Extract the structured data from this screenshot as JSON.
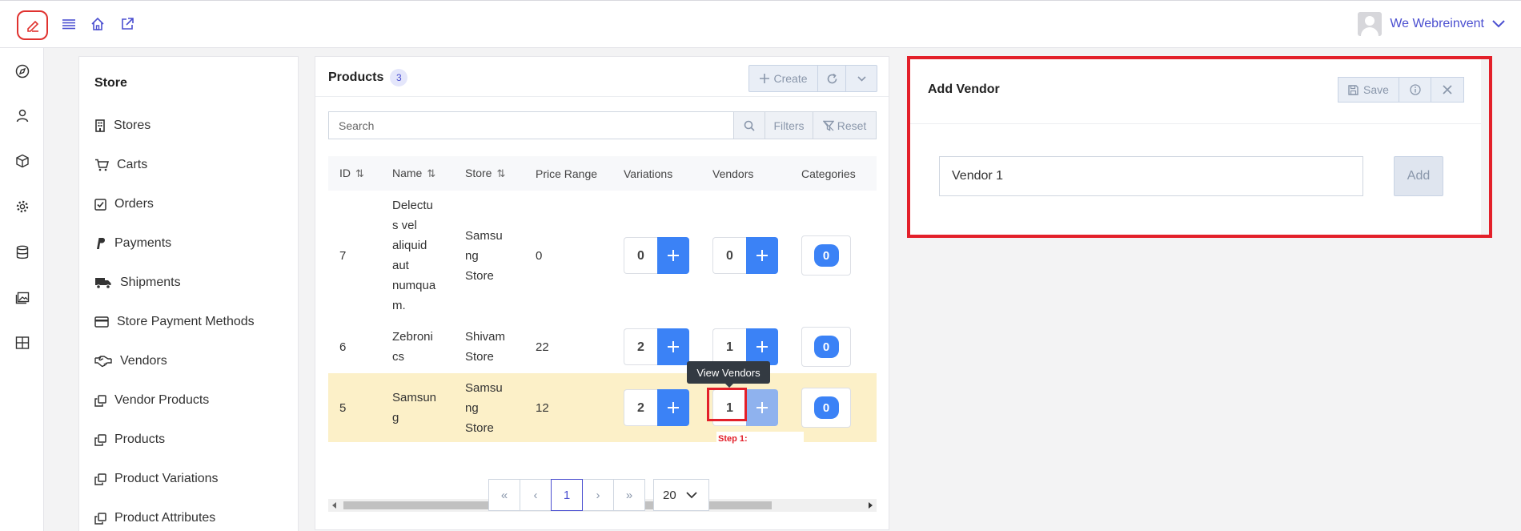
{
  "topbar": {
    "icons": [
      "pencil-logo-icon",
      "menu-icon",
      "home-icon",
      "external-link-icon"
    ],
    "user_name": "We Webreinvent"
  },
  "rail": {
    "icons": [
      "compass-icon",
      "user-icon",
      "cube-icon",
      "gear-icon",
      "database-icon",
      "images-icon",
      "grid-icon"
    ]
  },
  "store": {
    "title": "Store",
    "items": [
      {
        "label": "Stores",
        "icon": "building-icon"
      },
      {
        "label": "Carts",
        "icon": "cart-icon"
      },
      {
        "label": "Orders",
        "icon": "check-square-icon"
      },
      {
        "label": "Payments",
        "icon": "paypal-icon"
      },
      {
        "label": "Shipments",
        "icon": "truck-icon"
      },
      {
        "label": "Store Payment Methods",
        "icon": "credit-card-icon"
      },
      {
        "label": "Vendors",
        "icon": "handshake-icon"
      },
      {
        "label": "Vendor Products",
        "icon": "copy-icon"
      },
      {
        "label": "Products",
        "icon": "copy-icon"
      },
      {
        "label": "Product Variations",
        "icon": "copy-icon"
      },
      {
        "label": "Product Attributes",
        "icon": "copy-icon"
      }
    ]
  },
  "products": {
    "title": "Products",
    "count": "3",
    "create_label": "Create",
    "search_placeholder": "Search",
    "filters_label": "Filters",
    "reset_label": "Reset",
    "columns": [
      "ID",
      "Name",
      "Store",
      "Price Range",
      "Variations",
      "Vendors",
      "Categories"
    ],
    "rows": [
      {
        "id": "7",
        "name_lines": [
          "Delectu",
          "s vel",
          "aliquid",
          "aut",
          "numqua",
          "m."
        ],
        "store_lines": [
          "Samsu",
          "ng",
          "Store"
        ],
        "price": "0",
        "variations": "0",
        "vendors": "0",
        "categories": "0"
      },
      {
        "id": "6",
        "name_lines": [
          "Zebroni",
          "cs"
        ],
        "store_lines": [
          "Shivam",
          "Store"
        ],
        "price": "22",
        "variations": "2",
        "vendors": "1",
        "categories": "0"
      },
      {
        "id": "5",
        "name_lines": [
          "Samsun",
          "g"
        ],
        "store_lines": [
          "Samsu",
          "ng",
          "Store"
        ],
        "price": "12",
        "variations": "2",
        "vendors": "1",
        "categories": "0"
      }
    ],
    "tooltip": "View Vendors",
    "step_label": "Step 1:",
    "pagination": {
      "current_page": "1",
      "per_page": "20"
    }
  },
  "vendor_panel": {
    "title": "Add Vendor",
    "save_label": "Save",
    "input_value": "Vendor 1",
    "add_label": "Add"
  },
  "colors": {
    "accent": "#3b82f6",
    "brand": "#4b4fd0",
    "highlight": "#e3202a",
    "row_highlight": "#fcf0c8"
  }
}
